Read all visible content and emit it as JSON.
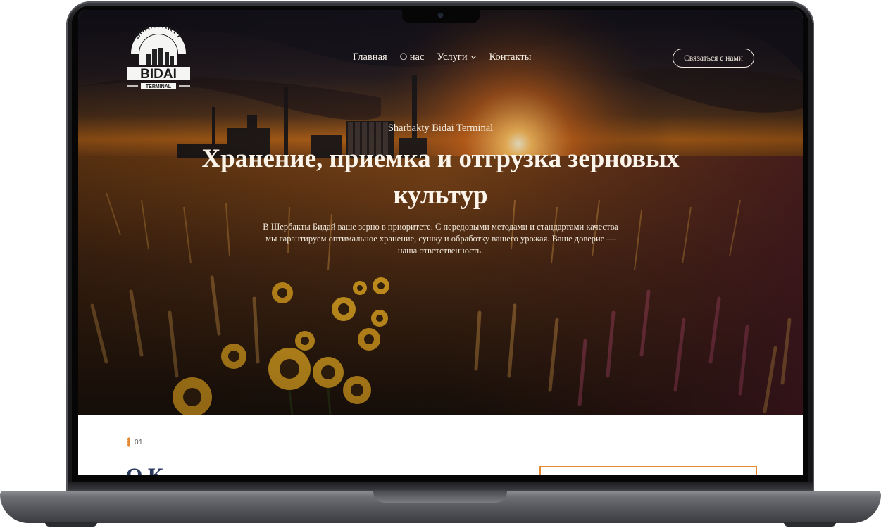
{
  "header": {
    "logo": {
      "arc_text": "SHARBAKTY",
      "name": "BIDAI",
      "sub": "TERMINAL"
    },
    "nav": [
      {
        "label": "Главная"
      },
      {
        "label": "О нас"
      },
      {
        "label": "Услуги"
      },
      {
        "label": "Контакты"
      }
    ],
    "cta_label": "Связаться с нами"
  },
  "hero": {
    "eyebrow": "Sharbakty Bidai Terminal",
    "headline": "Хранение, приемка и отгрузка зерновых культур",
    "lead": "В Шербакты Бидай ваше зерно в приоритете. С передовыми методами и стандартами качества мы гарантируем оптимальное хранение, сушку и обработку вашего урожая. Ваше доверие — наша ответственность."
  },
  "section": {
    "number": "01",
    "title": "О К"
  },
  "colors": {
    "accent": "#e38a33",
    "title": "#28385e",
    "hero_text": "#fbf4ea"
  },
  "icons": [
    "wheat-icon",
    "chevron-down-icon"
  ]
}
